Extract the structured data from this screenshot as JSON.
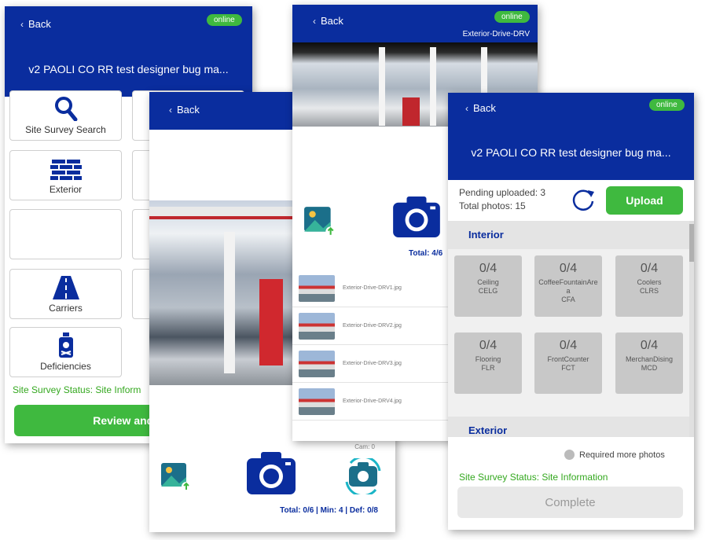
{
  "screen1": {
    "back": "Back",
    "online": "online",
    "title": "v2 PAOLI CO RR test designer bug ma...",
    "tiles": {
      "search": "Site Survey Search",
      "exterior": "Exterior",
      "carriers": "Carriers",
      "deficiencies": "Deficiencies"
    },
    "status": "Site Survey Status: Site Inform",
    "review_btn": "Review and Co"
  },
  "screen2": {
    "back": "Back",
    "cam": "Cam: 0",
    "totals": "Total: 0/6 | Min: 4 | Def: 0/8"
  },
  "screen3": {
    "back": "Back",
    "online": "online",
    "subtitle": "Exterior-Drive-DRV",
    "total": "Total: 4/6",
    "files": [
      "Exterior-Drive-DRV1.jpg",
      "Exterior-Drive-DRV2.jpg",
      "Exterior-Drive-DRV3.jpg",
      "Exterior-Drive-DRV4.jpg"
    ]
  },
  "screen4": {
    "back": "Back",
    "online": "online",
    "title": "v2 PAOLI CO RR test designer bug ma...",
    "pending": "Pending uploaded: 3",
    "total_photos": "Total photos: 15",
    "upload": "Upload",
    "section_interior": "Interior",
    "section_exterior": "Exterior",
    "categories": [
      {
        "count": "0/4",
        "name": "Ceiling",
        "code": "CELG"
      },
      {
        "count": "0/4",
        "name": "CoffeeFountainArea",
        "code": "CFA"
      },
      {
        "count": "0/4",
        "name": "Coolers",
        "code": "CLRS"
      },
      {
        "count": "0/4",
        "name": "Flooring",
        "code": "FLR"
      },
      {
        "count": "0/4",
        "name": "FrontCounter",
        "code": "FCT"
      },
      {
        "count": "0/4",
        "name": "MerchanDising",
        "code": "MCD"
      }
    ],
    "legend": "Required more photos",
    "status": "Site Survey Status: Site Information",
    "complete": "Complete"
  },
  "colors": {
    "brand": "#0a2d9e",
    "accent": "#3fb93f"
  }
}
